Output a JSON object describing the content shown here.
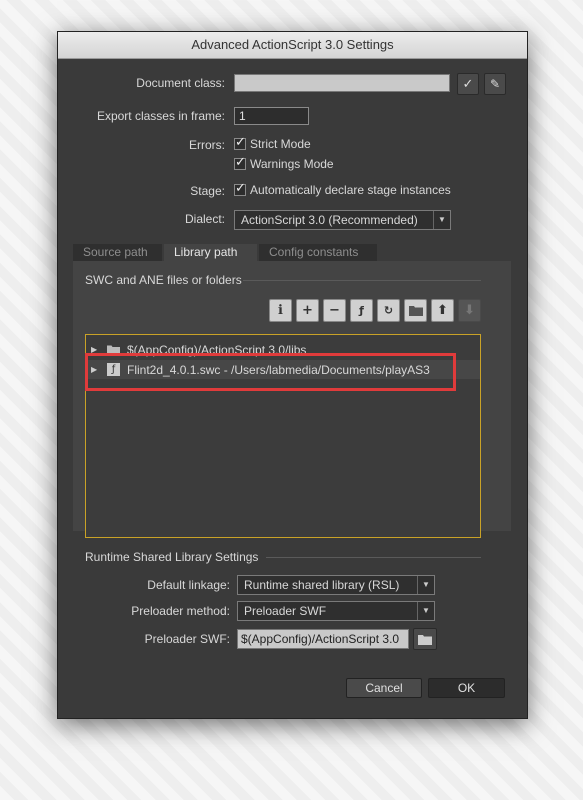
{
  "window": {
    "title": "Advanced ActionScript 3.0 Settings"
  },
  "document_class": {
    "label": "Document class:",
    "value": ""
  },
  "export_frame": {
    "label": "Export classes in frame:",
    "value": "1"
  },
  "errors": {
    "label": "Errors:",
    "strict_mode": "Strict Mode",
    "warnings_mode": "Warnings Mode"
  },
  "stage": {
    "label": "Stage:",
    "auto_declare": "Automatically declare stage instances"
  },
  "dialect": {
    "label": "Dialect:",
    "value": "ActionScript 3.0 (Recommended)"
  },
  "tabs": [
    {
      "label": "Source path",
      "active": false
    },
    {
      "label": "Library path",
      "active": true
    },
    {
      "label": "Config constants",
      "active": false
    }
  ],
  "library": {
    "section_title": "SWC and ANE files or folders",
    "items": [
      {
        "label": "$(AppConfig)/ActionScript 3.0/libs",
        "icon": "folder-icon"
      },
      {
        "label": "Flint2d_4.0.1.swc - /Users/labmedia/Documents/playAS3",
        "icon": "swc-file-icon"
      }
    ]
  },
  "rsl": {
    "section_title": "Runtime Shared Library Settings",
    "default_linkage_label": "Default linkage:",
    "default_linkage_value": "Runtime shared library (RSL)",
    "preloader_method_label": "Preloader method:",
    "preloader_method_value": "Preloader SWF",
    "preloader_swf_label": "Preloader SWF:",
    "preloader_swf_value": "$(AppConfig)/ActionScript 3.0"
  },
  "buttons": {
    "cancel": "Cancel",
    "ok": "OK"
  },
  "colors": {
    "highlight": "#e03b3b",
    "list_border": "#c9a227"
  }
}
